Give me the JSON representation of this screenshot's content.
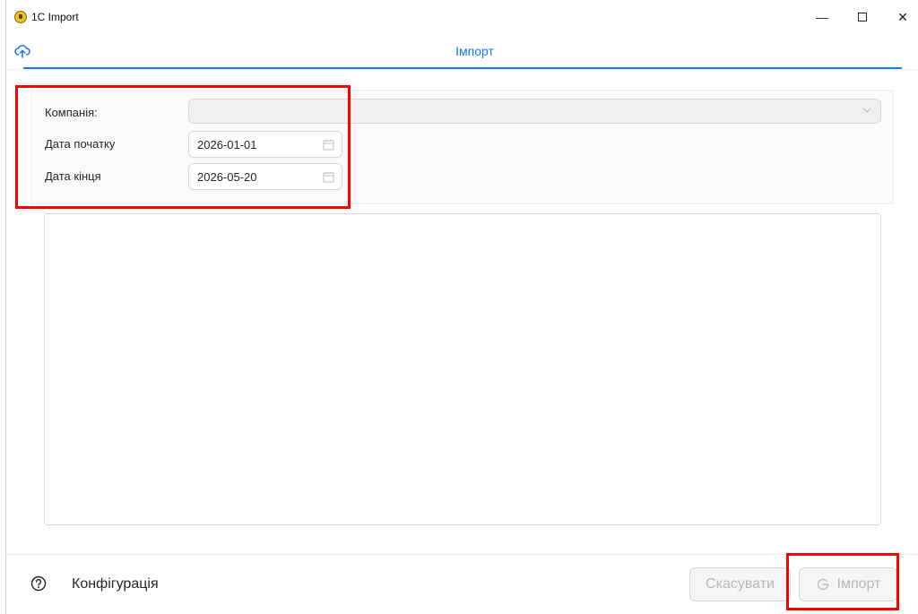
{
  "window": {
    "title": "1C Import",
    "controls": {
      "minimize": "—",
      "close": "✕"
    }
  },
  "tabs": [
    {
      "label": "Імпорт",
      "icon": "cloud-upload-icon",
      "active": true
    }
  ],
  "form": {
    "company_label": "Компанія:",
    "company_value": "",
    "start_date_label": "Дата початку",
    "start_date_value": "2026-01-01",
    "end_date_label": "Дата кінця",
    "end_date_value": "2026-05-20"
  },
  "log": {
    "content": ""
  },
  "footer": {
    "help_icon": "question-circle-icon",
    "config_label": "Конфігурація",
    "cancel_label": "Скасувати",
    "import_label": "Імпорт",
    "import_icon": "reload-icon"
  },
  "colors": {
    "accent": "#1677ff",
    "highlight": "#ff0000",
    "disabled_text": "#b8b8b8"
  }
}
